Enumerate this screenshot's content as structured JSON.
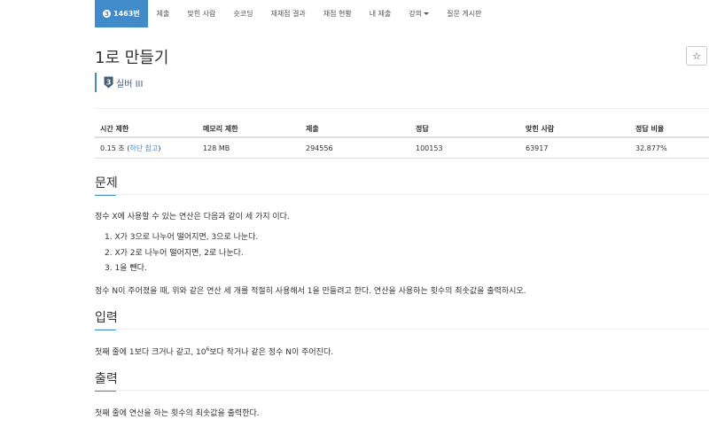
{
  "nav": {
    "problem_tab": {
      "tier_number": "3",
      "label": "1463번"
    },
    "tabs": [
      {
        "label": "제출"
      },
      {
        "label": "맞힌 사람"
      },
      {
        "label": "숏코딩"
      },
      {
        "label": "재채점 결과"
      },
      {
        "label": "채점 현황"
      },
      {
        "label": "내 제출"
      },
      {
        "label": "강의"
      },
      {
        "label": "질문 게시판"
      }
    ]
  },
  "problem": {
    "title": "1로 만들기",
    "tier_number": "3",
    "tier_label": "실버 III",
    "star_label": "☆"
  },
  "info_table": {
    "headers": [
      "시간 제한",
      "메모리 제한",
      "제출",
      "정답",
      "맞힌 사람",
      "정답 비율"
    ],
    "time_limit": "0.15 초",
    "time_note": "하단 참고",
    "memory_limit": "128 MB",
    "submissions": "294556",
    "accepted": "100153",
    "solvers": "63917",
    "ratio": "32.877%"
  },
  "description": {
    "heading": "문제",
    "intro": "정수 X에 사용할 수 있는 연산은 다음과 같이 세 가지 이다.",
    "operations": [
      "X가 3으로 나누어 떨어지면, 3으로 나눈다.",
      "X가 2로 나누어 떨어지면, 2로 나눈다.",
      "1을 뺀다."
    ],
    "task": "정수 N이 주어졌을 때, 위와 같은 연산 세 개를 적절히 사용해서 1을 만들려고 한다. 연산을 사용하는 횟수의 최솟값을 출력하시오."
  },
  "input_section": {
    "heading": "입력",
    "text_before": "첫째 줄에 1보다 크거나 같고, 10",
    "exponent": "6",
    "text_after": "보다 작거나 같은 정수 N이 주어진다."
  },
  "output_section": {
    "heading": "출력",
    "text": "첫째 줄에 연산을 하는 횟수의 최솟값을 출력한다."
  },
  "colors": {
    "accent": "#428bca",
    "tier_silver": "#435f7a"
  }
}
